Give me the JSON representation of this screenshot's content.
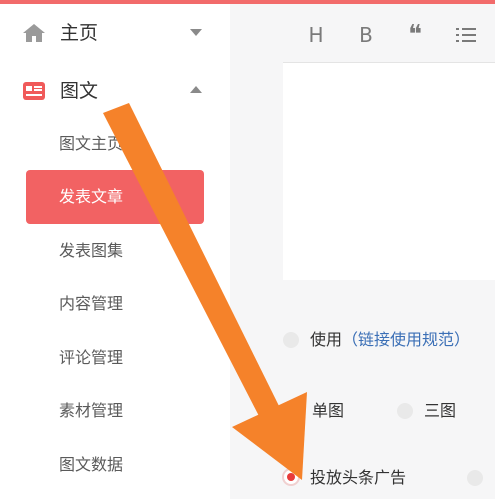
{
  "colors": {
    "accent": "#f26263",
    "link": "#3b6fb6",
    "arrow": "#f5822a"
  },
  "sidebar": {
    "home": {
      "label": "主页",
      "icon": "home-icon",
      "chevron": "chevron-down-icon"
    },
    "graphic": {
      "label": "图文",
      "icon": "article-icon",
      "chevron": "chevron-up-icon"
    },
    "items": [
      {
        "label": "图文主页"
      },
      {
        "label": "发表文章",
        "active": true
      },
      {
        "label": "发表图集"
      },
      {
        "label": "内容管理"
      },
      {
        "label": "评论管理"
      },
      {
        "label": "素材管理"
      },
      {
        "label": "图文数据"
      }
    ]
  },
  "toolbar": {
    "heading": "H",
    "bold": "B",
    "quote": "❝",
    "list_icon": "list-icon"
  },
  "options": {
    "use_label": "使用",
    "link_prefix": "（",
    "link_text": "链接使用规范",
    "link_suffix": "）",
    "single_image": "单图",
    "three_image": "三图",
    "ad_label": "投放头条广告"
  },
  "annotation": {
    "arrow": "orange-arrow-icon"
  }
}
